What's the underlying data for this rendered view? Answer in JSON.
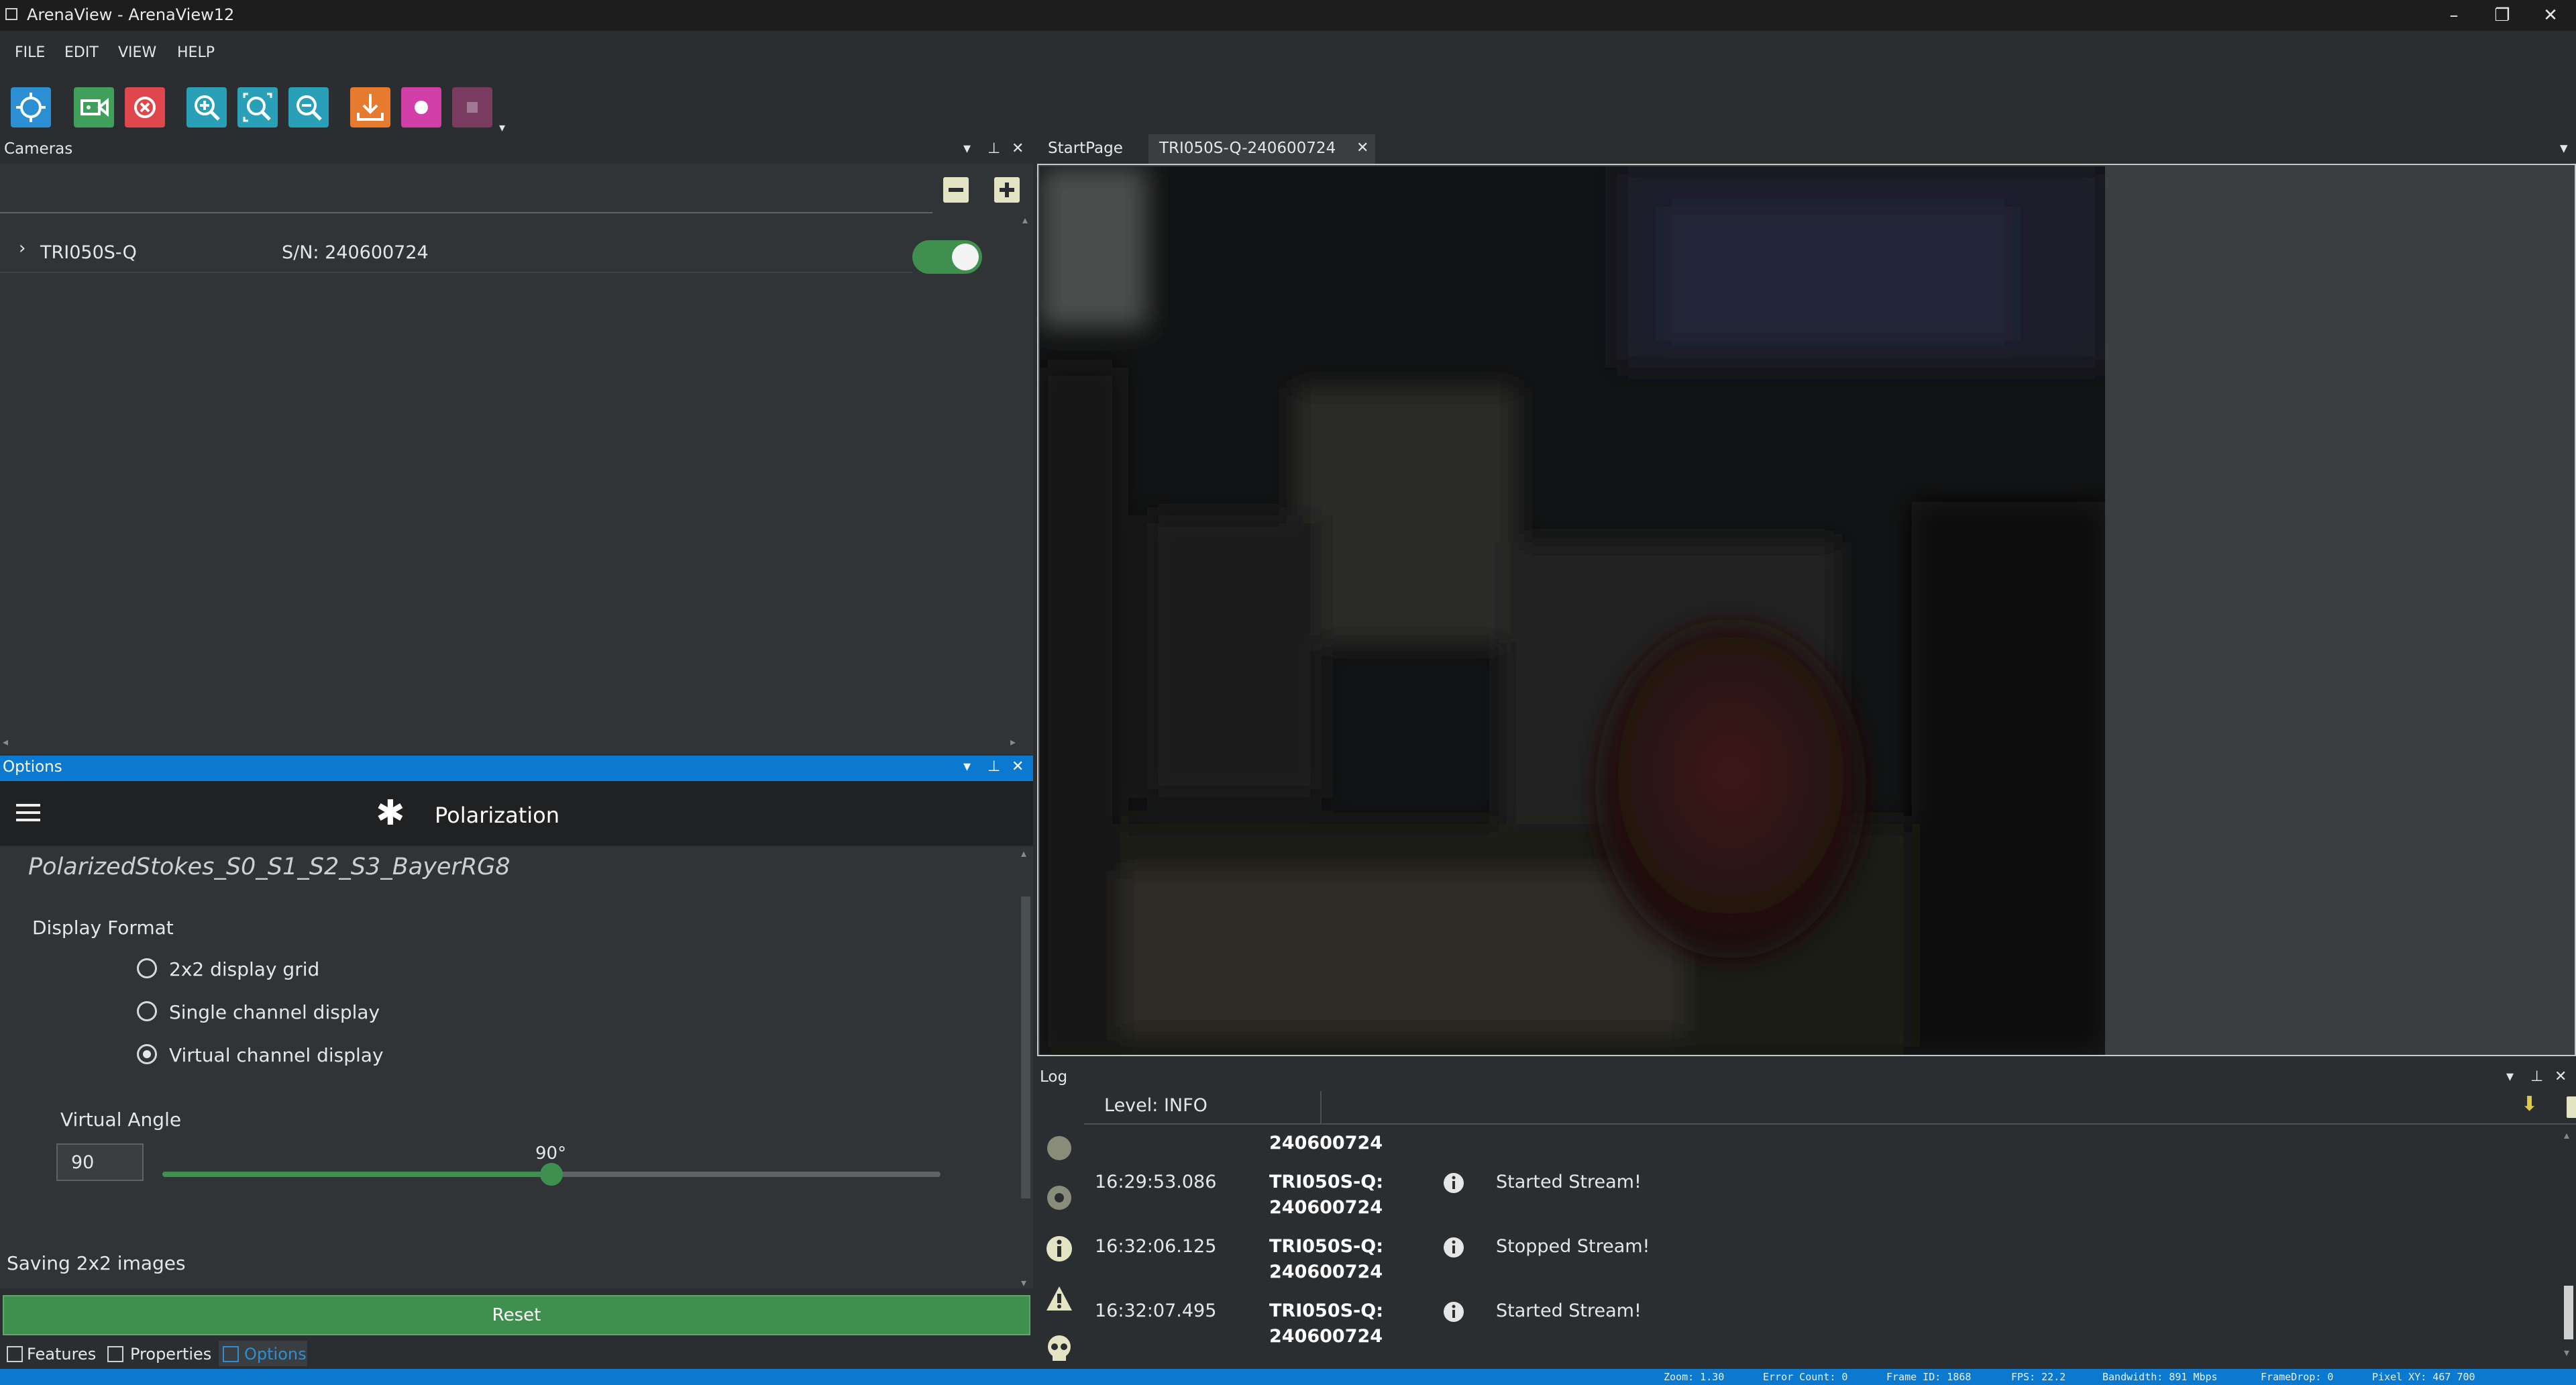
{
  "window": {
    "title": "ArenaView - ArenaView12"
  },
  "menu": [
    "FILE",
    "EDIT",
    "VIEW",
    "HELP"
  ],
  "toolbar": {
    "icons": [
      "crosshair-icon",
      "video-camera-icon",
      "close-circle-icon",
      "zoom-in-icon",
      "zoom-fit-icon",
      "zoom-out-icon",
      "download-icon",
      "record-icon",
      "stop-icon"
    ]
  },
  "cameras": {
    "title": "Cameras",
    "device": {
      "model": "TRI050S-Q",
      "serial": "S/N: 240600724",
      "enabled": true
    }
  },
  "options": {
    "title": "Options",
    "header": "Polarization",
    "pixel_format": "PolarizedStokes_S0_S1_S2_S3_BayerRG8",
    "display_format_label": "Display Format",
    "display_options": [
      "2x2 display grid",
      "Single channel display",
      "Virtual channel display"
    ],
    "selected_display": 2,
    "virtual_angle_label": "Virtual Angle",
    "virtual_angle_value": "90",
    "virtual_angle_display": "90°",
    "slider_fraction": 0.5,
    "saving_label": "Saving 2x2 images",
    "reset_label": "Reset"
  },
  "bottom_tabs": [
    "Features",
    "Properties",
    "Options"
  ],
  "tabs": {
    "start": "StartPage",
    "camera": "TRI050S-Q-240600724"
  },
  "log": {
    "title": "Log",
    "level": "Level: INFO",
    "partial_source": "240600724",
    "entries": [
      {
        "time": "16:29:53.086",
        "source1": "TRI050S-Q:",
        "source2": "240600724",
        "message": "Started Stream!"
      },
      {
        "time": "16:32:06.125",
        "source1": "TRI050S-Q:",
        "source2": "240600724",
        "message": "Stopped Stream!"
      },
      {
        "time": "16:32:07.495",
        "source1": "TRI050S-Q:",
        "source2": "240600724",
        "message": "Started Stream!"
      }
    ]
  },
  "status": {
    "zoom": "Zoom: 1.30",
    "errors": "Error Count: 0",
    "frame": "Frame ID: 1868",
    "fps": "FPS: 22.2",
    "bandwidth": "Bandwidth: 891 Mbps",
    "framedrop": "FrameDrop: 0",
    "pixel": "Pixel XY: 467 700"
  },
  "colors": {
    "accent": "#0a79cf",
    "green": "#3f8f4e"
  }
}
